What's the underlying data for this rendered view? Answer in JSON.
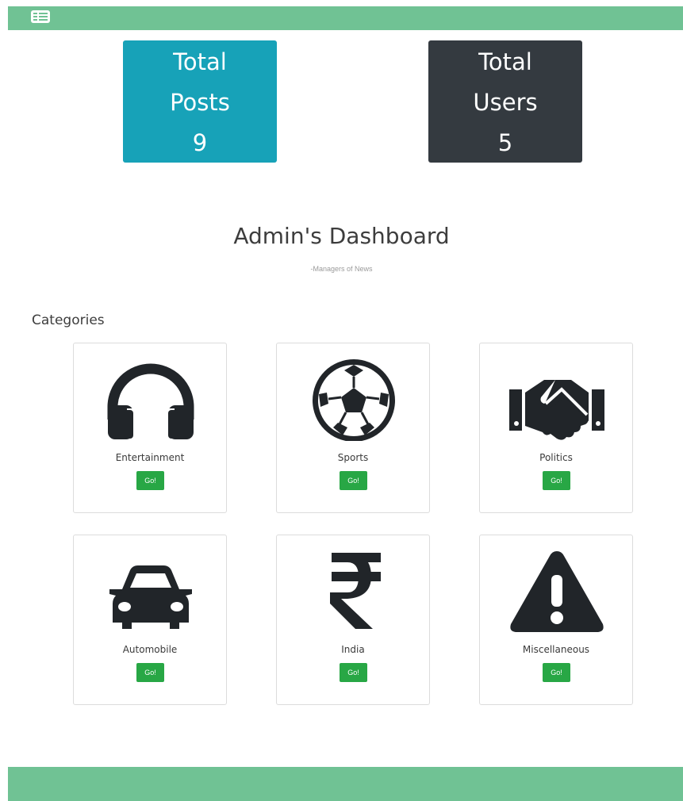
{
  "header": {
    "menu_icon": "list-icon"
  },
  "stats": {
    "posts": {
      "line1": "Total",
      "line2": "Posts",
      "value": "9",
      "color": "#17a2b8"
    },
    "users": {
      "line1": "Total",
      "line2": "Users",
      "value": "5",
      "color": "#343a40"
    }
  },
  "dashboard": {
    "title": "Admin's Dashboard",
    "subtitle": "-Managers of News"
  },
  "categories": {
    "title": "Categories",
    "items": [
      {
        "label": "Entertainment",
        "icon": "headphones-icon",
        "button": "Go!"
      },
      {
        "label": "Sports",
        "icon": "soccer-ball-icon",
        "button": "Go!"
      },
      {
        "label": "Politics",
        "icon": "handshake-icon",
        "button": "Go!"
      },
      {
        "label": "Automobile",
        "icon": "car-icon",
        "button": "Go!"
      },
      {
        "label": "India",
        "icon": "rupee-icon",
        "button": "Go!"
      },
      {
        "label": "Miscellaneous",
        "icon": "warning-icon",
        "button": "Go!"
      }
    ]
  },
  "colors": {
    "bar": "#70c294",
    "button": "#28a745",
    "icon": "#212529"
  }
}
